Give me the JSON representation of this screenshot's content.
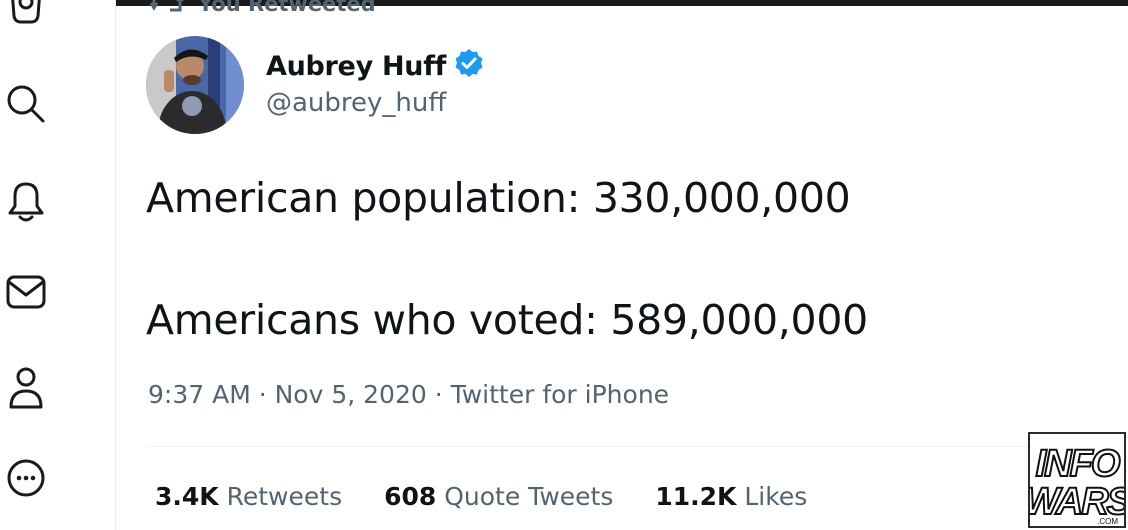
{
  "sidebar": {
    "items": [
      {
        "icon": "camera-icon"
      },
      {
        "icon": "search-icon"
      },
      {
        "icon": "bell-icon"
      },
      {
        "icon": "mail-icon"
      },
      {
        "icon": "profile-icon"
      },
      {
        "icon": "more-icon"
      }
    ]
  },
  "tweet": {
    "retweet_label": "You Retweeted",
    "author": {
      "display_name": "Aubrey Huff",
      "handle": "@aubrey_huff",
      "verified": true
    },
    "text_lines": [
      "American population: 330,000,000",
      "Americans who voted: 589,000,000"
    ],
    "meta": "9:37 AM · Nov 5, 2020 · Twitter for iPhone",
    "stats": {
      "retweets": {
        "count": "3.4K",
        "label": "Retweets"
      },
      "quotes": {
        "count": "608",
        "label": "Quote Tweets"
      },
      "likes": {
        "count": "11.2K",
        "label": "Likes"
      }
    }
  },
  "watermark": {
    "line1": "INFO",
    "line2": "WARS",
    "suffix": ".COM"
  },
  "colors": {
    "text_primary": "#0f1419",
    "text_secondary": "#536471",
    "verified_blue": "#1d9bf0"
  }
}
